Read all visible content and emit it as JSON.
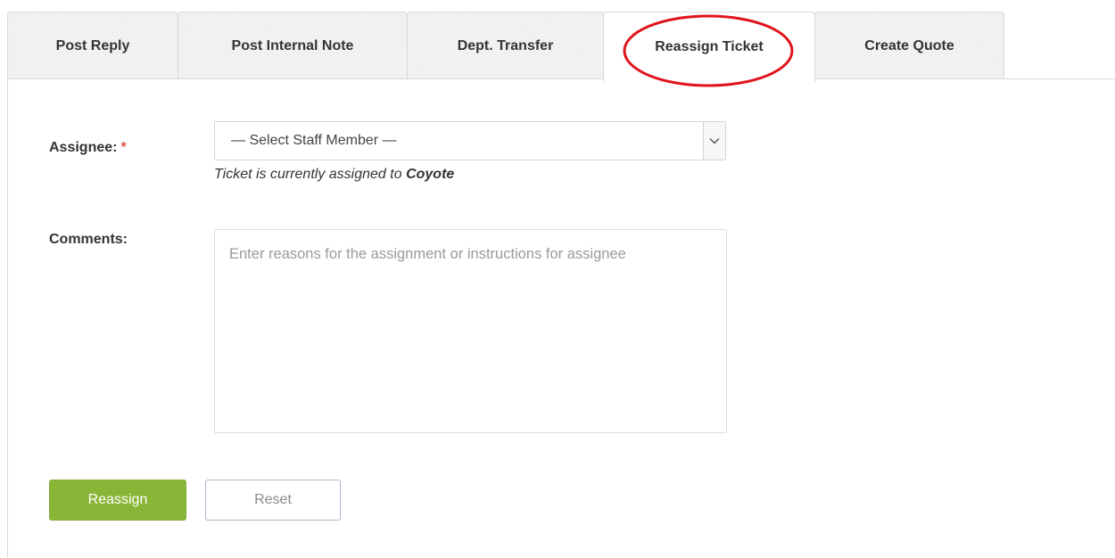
{
  "tabs": [
    {
      "label": "Post Reply",
      "active": false
    },
    {
      "label": "Post Internal Note",
      "active": false
    },
    {
      "label": "Dept. Transfer",
      "active": false
    },
    {
      "label": "Reassign Ticket",
      "active": true
    },
    {
      "label": "Create Quote",
      "active": false
    }
  ],
  "highlight": {
    "target": "Reassign Ticket",
    "color": "#e0141c"
  },
  "form": {
    "assignee_label": "Assignee:",
    "required_marker": "*",
    "assignee_select": {
      "selected": "— Select Staff Member —",
      "icon": "chevron-down-icon"
    },
    "assignment_hint_prefix": "Ticket is currently assigned to ",
    "assignment_hint_name": "Coyote",
    "comments_label": "Comments:",
    "comments_value": "",
    "comments_placeholder": "Enter reasons for the assignment or instructions for assignee"
  },
  "buttons": {
    "reassign_label": "Reassign",
    "reset_label": "Reset"
  },
  "colors": {
    "primary_button": "#88b637",
    "required_star": "#d9534f",
    "highlight": "#e0141c"
  }
}
